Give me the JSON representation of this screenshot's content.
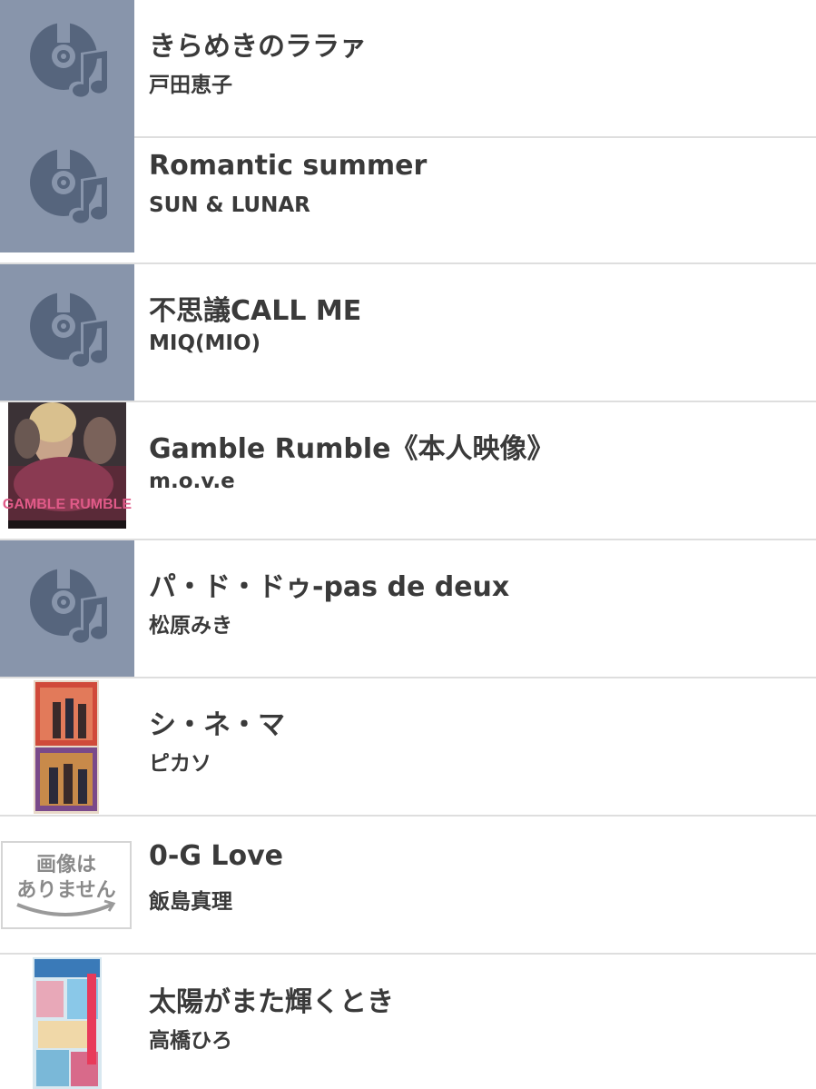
{
  "colors": {
    "placeholder_bg": "#8895ab",
    "placeholder_icon": "#56657d",
    "divider": "#dedede",
    "text": "#3a3a3a"
  },
  "songs": [
    {
      "title": "きらめきのララァ",
      "artist": "戸田恵子",
      "thumb": "music-cd-icon"
    },
    {
      "title": "Romantic summer",
      "artist": "SUN & LUNAR",
      "thumb": "music-cd-icon"
    },
    {
      "title": "不思議CALL ME",
      "artist": "MIQ(MIO)",
      "thumb": "music-cd-icon"
    },
    {
      "title": "Gamble Rumble《本人映像》",
      "artist": "m.o.v.e",
      "thumb": "album-art",
      "art_text": "GAMBLE RUMBLE"
    },
    {
      "title": "パ・ド・ドゥ-pas de deux",
      "artist": "松原みき",
      "thumb": "music-cd-icon"
    },
    {
      "title": "シ・ネ・マ",
      "artist": "ピカソ",
      "thumb": "album-art"
    },
    {
      "title": "0-G Love",
      "artist": "飯島真理",
      "thumb": "no-image",
      "no_image_line1": "画像は",
      "no_image_line2": "ありません"
    },
    {
      "title": "太陽がまた輝くとき",
      "artist": "高橋ひろ",
      "thumb": "album-art"
    }
  ]
}
